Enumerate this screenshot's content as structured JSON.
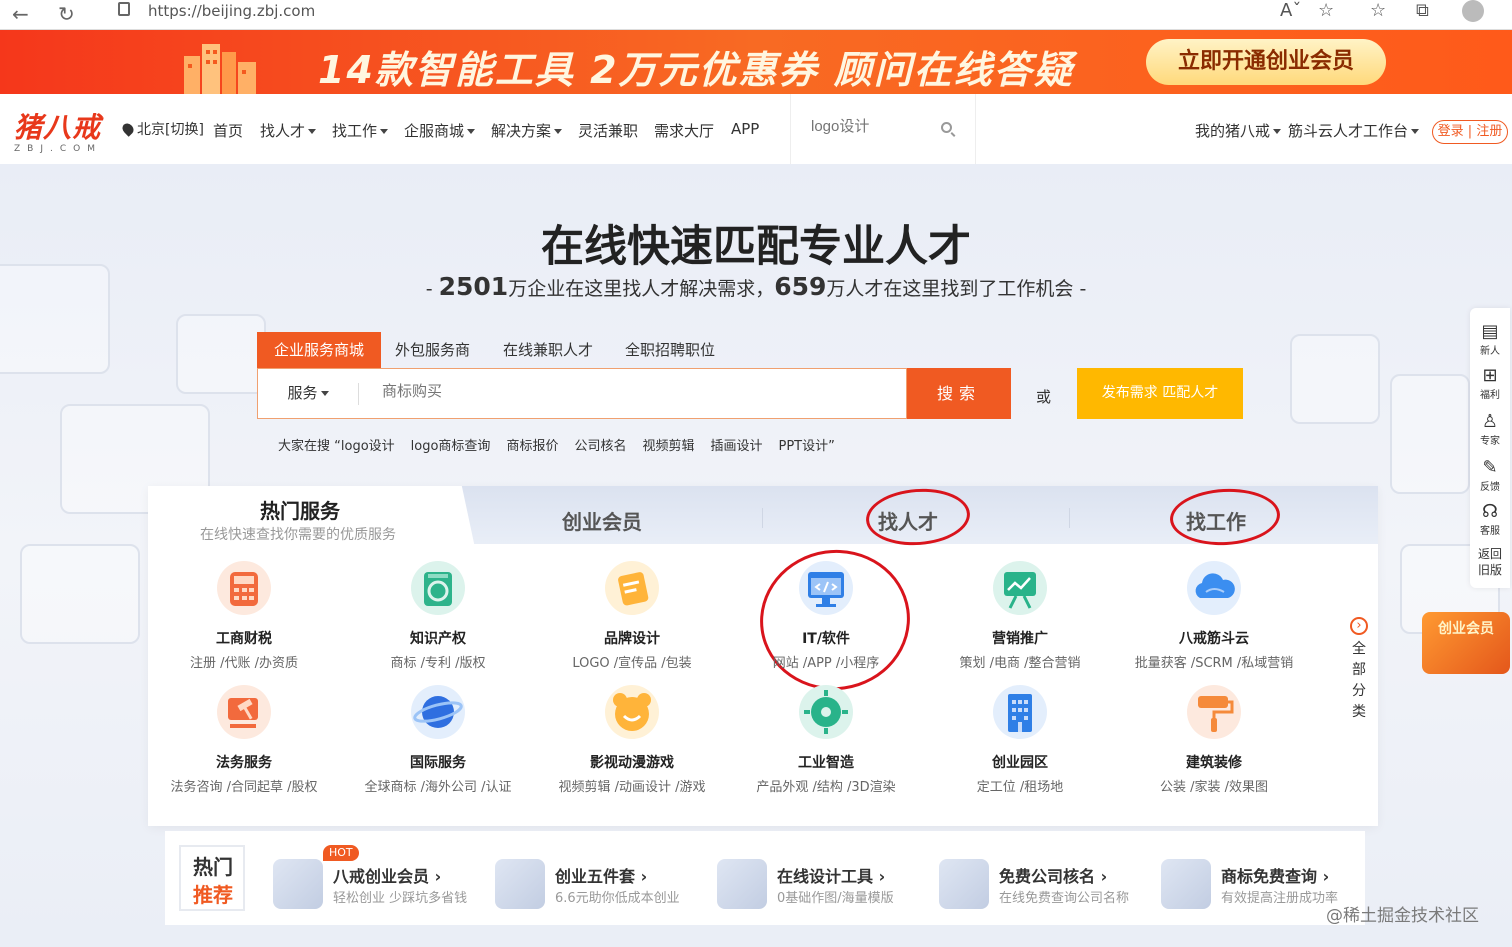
{
  "browser": {
    "url": "https://beijing.zbj.com"
  },
  "banner": {
    "headline": "14款智能工具  2万元优惠券  顾问在线答疑",
    "cta": "立即开通创业会员"
  },
  "header": {
    "logo_cn": "猪八戒",
    "logo_en": "ZBJ.COM",
    "location": "北京[切换]",
    "nav": [
      "首页",
      "找人才",
      "找工作",
      "企服商城",
      "解决方案",
      "灵活兼职",
      "需求大厅",
      "APP"
    ],
    "search_placeholder": "logo设计",
    "my_zbj": "我的猪八戒",
    "workbench": "筋斗云人才工作台",
    "login": "登录",
    "register": "注册"
  },
  "hero": {
    "title": "在线快速匹配专业人才",
    "sub_num1": "2501",
    "sub_text1": "万企业在这里找人才解决需求，",
    "sub_num2": "659",
    "sub_text2": "万人才在这里找到了工作机会",
    "tabs": [
      "企业服务商城",
      "外包服务商",
      "在线兼职人才",
      "全职招聘职位"
    ],
    "category": "服务",
    "search_placeholder": "商标购买",
    "search_button": "搜索",
    "or": "或",
    "publish_button": "发布需求 匹配人才",
    "hot_prefix": "大家在搜 “",
    "hot_words": [
      "logo设计",
      "logo商标查询",
      "商标报价",
      "公司核名",
      "视频剪辑",
      "插画设计",
      "PPT设计”"
    ]
  },
  "services_card": {
    "tab_hot_title": "热门服务",
    "tab_hot_sub": "在线快速查找你需要的优质服务",
    "tabs": [
      "创业会员",
      "找人才",
      "找工作"
    ],
    "items": [
      {
        "name": "工商财税",
        "desc": "注册 /代账 /办资质",
        "color": "#f26a3d"
      },
      {
        "name": "知识产权",
        "desc": "商标 /专利 /版权",
        "color": "#2eb38b"
      },
      {
        "name": "品牌设计",
        "desc": "LOGO /宣传品 /包装",
        "color": "#ffb43a"
      },
      {
        "name": "IT/软件",
        "desc": "网站 /APP /小程序",
        "color": "#2f7fe6"
      },
      {
        "name": "营销推广",
        "desc": "策划 /电商 /整合营销",
        "color": "#29b38a"
      },
      {
        "name": "八戒筋斗云",
        "desc": "批量获客 /SCRM /私域营销",
        "color": "#3b8ef0"
      },
      {
        "name": "法务服务",
        "desc": "法务咨询 /合同起草 /股权",
        "color": "#f26a3d"
      },
      {
        "name": "国际服务",
        "desc": "全球商标 /海外公司 /认证",
        "color": "#2f6fe0"
      },
      {
        "name": "影视动漫游戏",
        "desc": "视频剪辑 /动画设计 /游戏",
        "color": "#ffb43a"
      },
      {
        "name": "工业智造",
        "desc": "产品外观 /结构 /3D渲染",
        "color": "#29b38a"
      },
      {
        "name": "创业园区",
        "desc": "定工位 /租场地",
        "color": "#2f7fe6"
      },
      {
        "name": "建筑装修",
        "desc": "公装 /家装 /效果图",
        "color": "#f58a3a"
      }
    ],
    "all_categories": [
      "全",
      "部",
      "分",
      "类"
    ]
  },
  "hot_recommend": {
    "label1": "热门",
    "label2": "推荐",
    "badge": "HOT",
    "items": [
      {
        "title": "八戒创业会员 ›",
        "sub": "轻松创业 少踩坑多省钱"
      },
      {
        "title": "创业五件套 ›",
        "sub": "6.6元助你低成本创业"
      },
      {
        "title": "在线设计工具 ›",
        "sub": "0基础作图/海量模版"
      },
      {
        "title": "免费公司核名 ›",
        "sub": "在线免费查询公司名称"
      },
      {
        "title": "商标免费查询 ›",
        "sub": "有效提高注册成功率"
      }
    ]
  },
  "right_sidebar": [
    "新人",
    "福利",
    "专家",
    "反馈",
    "客服"
  ],
  "return_old": "返回旧版",
  "vip_badge": "创业会员",
  "watermark": "@稀土掘金技术社区"
}
